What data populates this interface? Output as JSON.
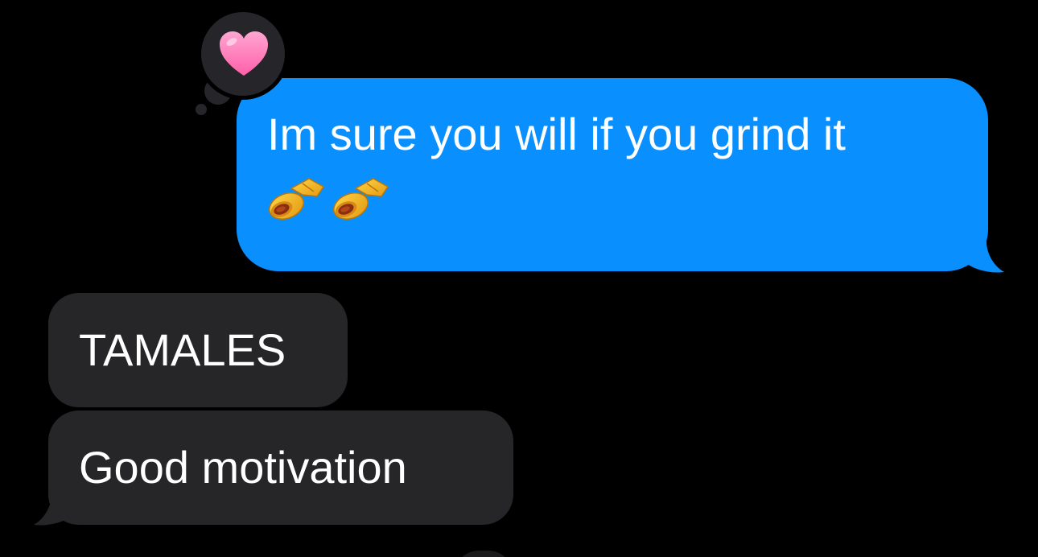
{
  "messages": [
    {
      "direction": "outgoing",
      "text": "Im sure you will if you grind it",
      "emoji": [
        "tamale",
        "tamale"
      ],
      "reaction": "heart"
    },
    {
      "direction": "incoming",
      "text": "TAMALES"
    },
    {
      "direction": "incoming",
      "text": "Good motivation"
    }
  ],
  "colors": {
    "background": "#000000",
    "outgoing_bubble": "#0A8FFF",
    "incoming_bubble": "#262629",
    "tapback_bubble": "#26252A",
    "heart": "#FF7FB8"
  },
  "icons": {
    "reaction": "heart-icon",
    "emoji": "tamale-emoji"
  }
}
